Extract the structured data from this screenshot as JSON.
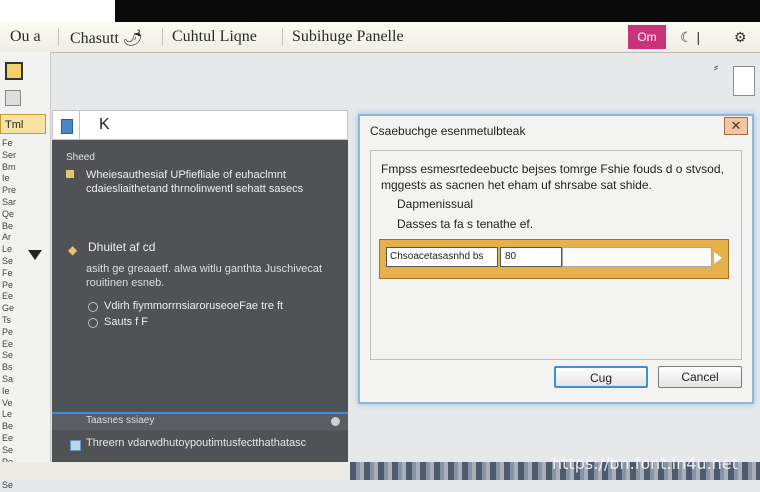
{
  "titlebar": {
    "app": "Ou a",
    "menu1": "Chasutt 🌶",
    "menu2": "Cuhtul Liqne",
    "menu3": "Subihuge Panelle",
    "tab": "Om",
    "icon_a": "moon-icon",
    "icon_b": "gear-icon"
  },
  "leftcol": {
    "selected_label": "Tml",
    "items": [
      "Fe",
      "Ser",
      "Bm",
      "Ie",
      "Pre",
      "Sar",
      "Qe",
      "Be",
      "Ar",
      "Le",
      "Se",
      "Fe",
      "Pe",
      "Ee",
      "Ge",
      "Ts",
      "Pe",
      "Ee",
      "Se",
      "Bs",
      "Sa",
      "Ie",
      "Ve",
      "Le",
      "Be",
      "Ee",
      "Se",
      "Pe",
      "Ve",
      "Se"
    ]
  },
  "panel": {
    "tab_label": "K",
    "section_label": "Sheed",
    "para1": "Wheiesauthesiaf UPfiefliale of euhaclmnt cdaiesliaithetand thrnolinwentl sehatt sasecs",
    "heading2": "Dhuitet af cd",
    "para2": "asith ge greaaetf. alwa witlu ganthta Juschivecat rouitinen esneb.",
    "radio1": "Vdirh fiymmorrnsiaroruseoeFae tre ft",
    "radio2": "Sauts f F",
    "footer1": "Taasnes ssiaey",
    "footer2": "Threern vdarwdhutoypoutimtusfectthathatasc"
  },
  "dialog": {
    "title": "Csaebuchge esenmetulbteak",
    "close_icon": "close-icon",
    "message": "Fmpss esmesrtedeebuctc bejses tomrge Fshie fouds d o stvsod, mggests as sacnen het eham uf shrsabe sat shide.",
    "line1": "Dapmenissual",
    "line2": "Dasses ta fa s tenathe ef.",
    "field_label": "Chsoacetasasnhd bs",
    "field_value": "80",
    "ok_label": "Cug",
    "cancel_label": "Cancel"
  },
  "watermark": "https://bn.font.in4u.net"
}
